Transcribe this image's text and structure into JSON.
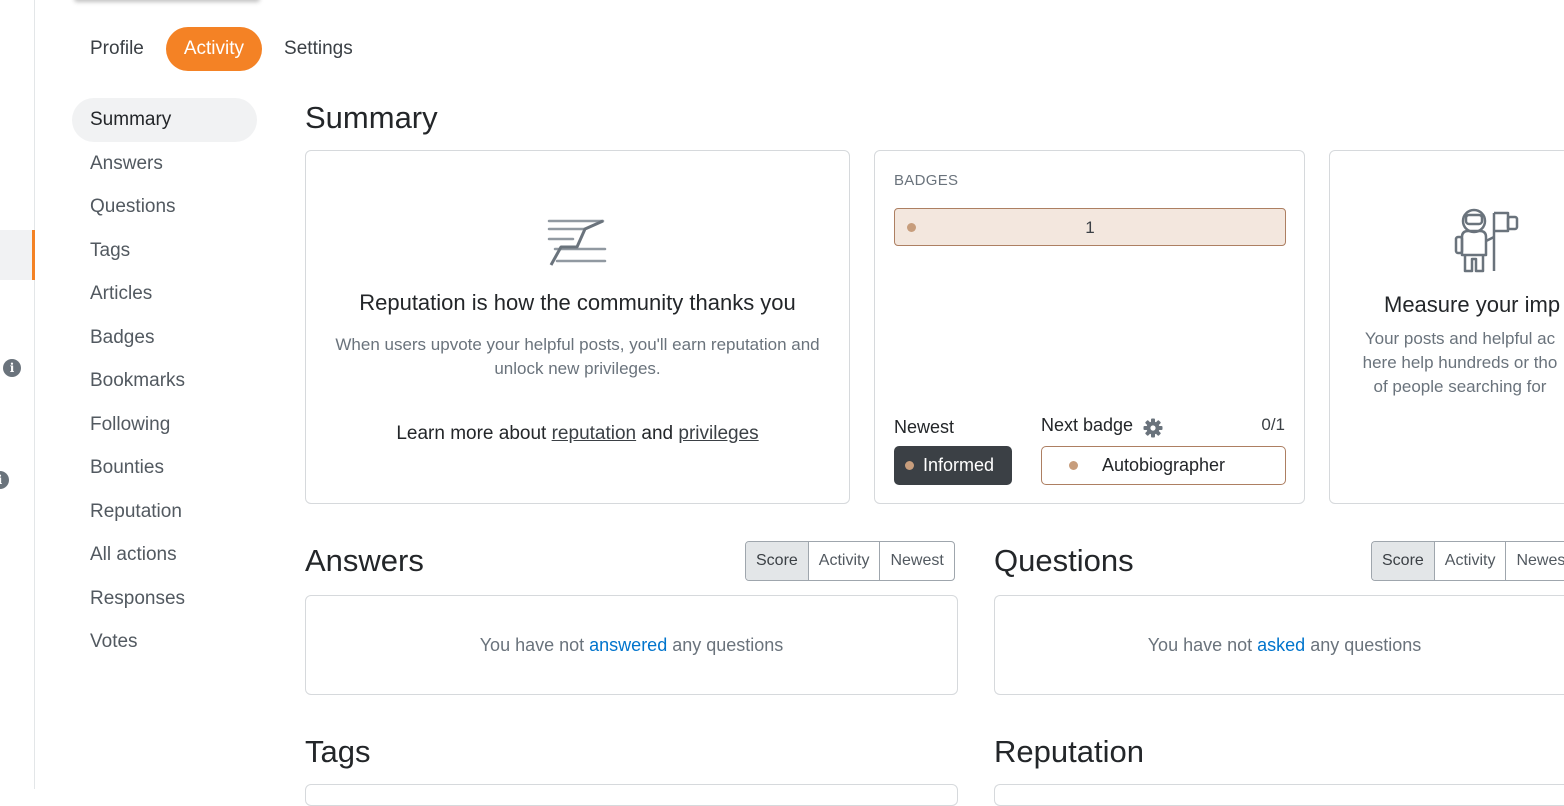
{
  "top_tabs": [
    "Profile",
    "Activity",
    "Settings"
  ],
  "side_nav": [
    "Summary",
    "Answers",
    "Questions",
    "Tags",
    "Articles",
    "Badges",
    "Bookmarks",
    "Following",
    "Bounties",
    "Reputation",
    "All actions",
    "Responses",
    "Votes"
  ],
  "summary": {
    "title": "Summary",
    "reputation_card": {
      "icon": "reputation-chart-icon",
      "title": "Reputation is how the community thanks you",
      "desc": "When users upvote your helpful posts, you'll earn reputation and unlock new privileges.",
      "learn_prefix": "Learn more about",
      "link1": "reputation",
      "and": "and",
      "link2": "privileges"
    },
    "badges_card": {
      "label": "BADGES",
      "bronze_count": "1",
      "newest_label": "Newest",
      "newest_badge": "Informed",
      "next_label": "Next badge",
      "next_progress": "0/1",
      "next_badge": "Autobiographer",
      "bronze_color": "#c79d7c"
    },
    "impact_card": {
      "icon": "astronaut-icon",
      "title": "Measure your imp",
      "desc_lines": [
        "Your posts and helpful ac",
        "here help hundreds or tho",
        "of people searching for"
      ]
    }
  },
  "answers": {
    "title": "Answers",
    "sort": [
      "Score",
      "Activity",
      "Newest"
    ],
    "selected": "Score",
    "empty_prefix": "You have not",
    "empty_link": "answered",
    "empty_suffix": "any questions"
  },
  "questions": {
    "title": "Questions",
    "sort": [
      "Score",
      "Activity",
      "Newes"
    ],
    "selected": "Score",
    "empty_prefix": "You have not",
    "empty_link": "asked",
    "empty_suffix": "any questions"
  },
  "tags_title": "Tags",
  "reputation_title": "Reputation",
  "colors": {
    "accent": "#f48225",
    "link": "#0074cc",
    "bronze_bg": "#f3e7de",
    "bronze_border": "#ad7f62",
    "dark_pill": "#3b4045"
  }
}
